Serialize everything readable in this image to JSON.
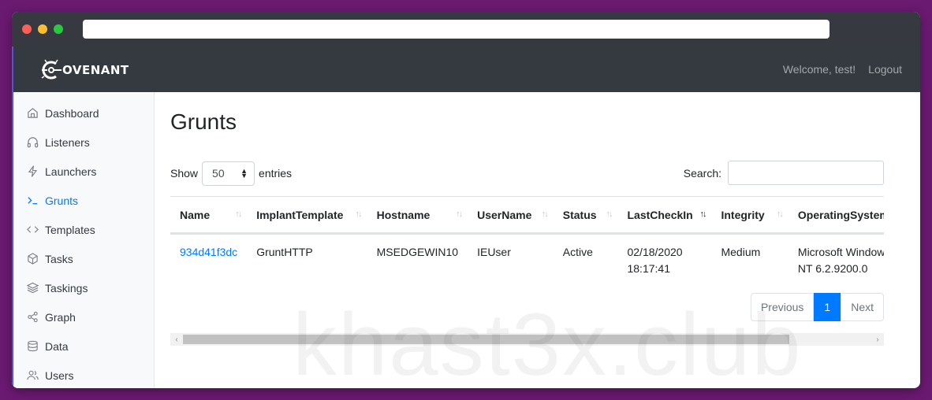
{
  "nav": {
    "brand": "OVENANT",
    "welcome": "Welcome, test!",
    "logout": "Logout"
  },
  "sidebar": {
    "items": [
      {
        "label": "Dashboard",
        "icon": "home-icon"
      },
      {
        "label": "Listeners",
        "icon": "headphones-icon"
      },
      {
        "label": "Launchers",
        "icon": "zap-icon"
      },
      {
        "label": "Grunts",
        "icon": "terminal-icon",
        "active": true
      },
      {
        "label": "Templates",
        "icon": "code-icon"
      },
      {
        "label": "Tasks",
        "icon": "box-icon"
      },
      {
        "label": "Taskings",
        "icon": "layers-icon"
      },
      {
        "label": "Graph",
        "icon": "share-icon"
      },
      {
        "label": "Data",
        "icon": "database-icon"
      },
      {
        "label": "Users",
        "icon": "users-icon"
      }
    ]
  },
  "page": {
    "title": "Grunts",
    "show_label": "Show",
    "entries_value": "50",
    "entries_label": "entries",
    "search_label": "Search:",
    "search_value": ""
  },
  "table": {
    "columns": [
      "Name",
      "ImplantTemplate",
      "Hostname",
      "UserName",
      "Status",
      "LastCheckIn",
      "Integrity",
      "OperatingSystem"
    ],
    "sorted_column": "LastCheckIn",
    "rows": [
      {
        "name": "934d41f3dc",
        "implant_template": "GruntHTTP",
        "hostname": "MSEDGEWIN10",
        "username": "IEUser",
        "status": "Active",
        "last_checkin_date": "02/18/2020",
        "last_checkin_time": "18:17:41",
        "integrity": "Medium",
        "os_line1": "Microsoft Windows",
        "os_line2": "NT 6.2.9200.0"
      }
    ]
  },
  "pagination": {
    "previous": "Previous",
    "current": "1",
    "next": "Next"
  },
  "watermark": "khast3x.club",
  "colors": {
    "accent": "#007bff",
    "navbar": "#343a40",
    "background": "#6b1a72"
  }
}
